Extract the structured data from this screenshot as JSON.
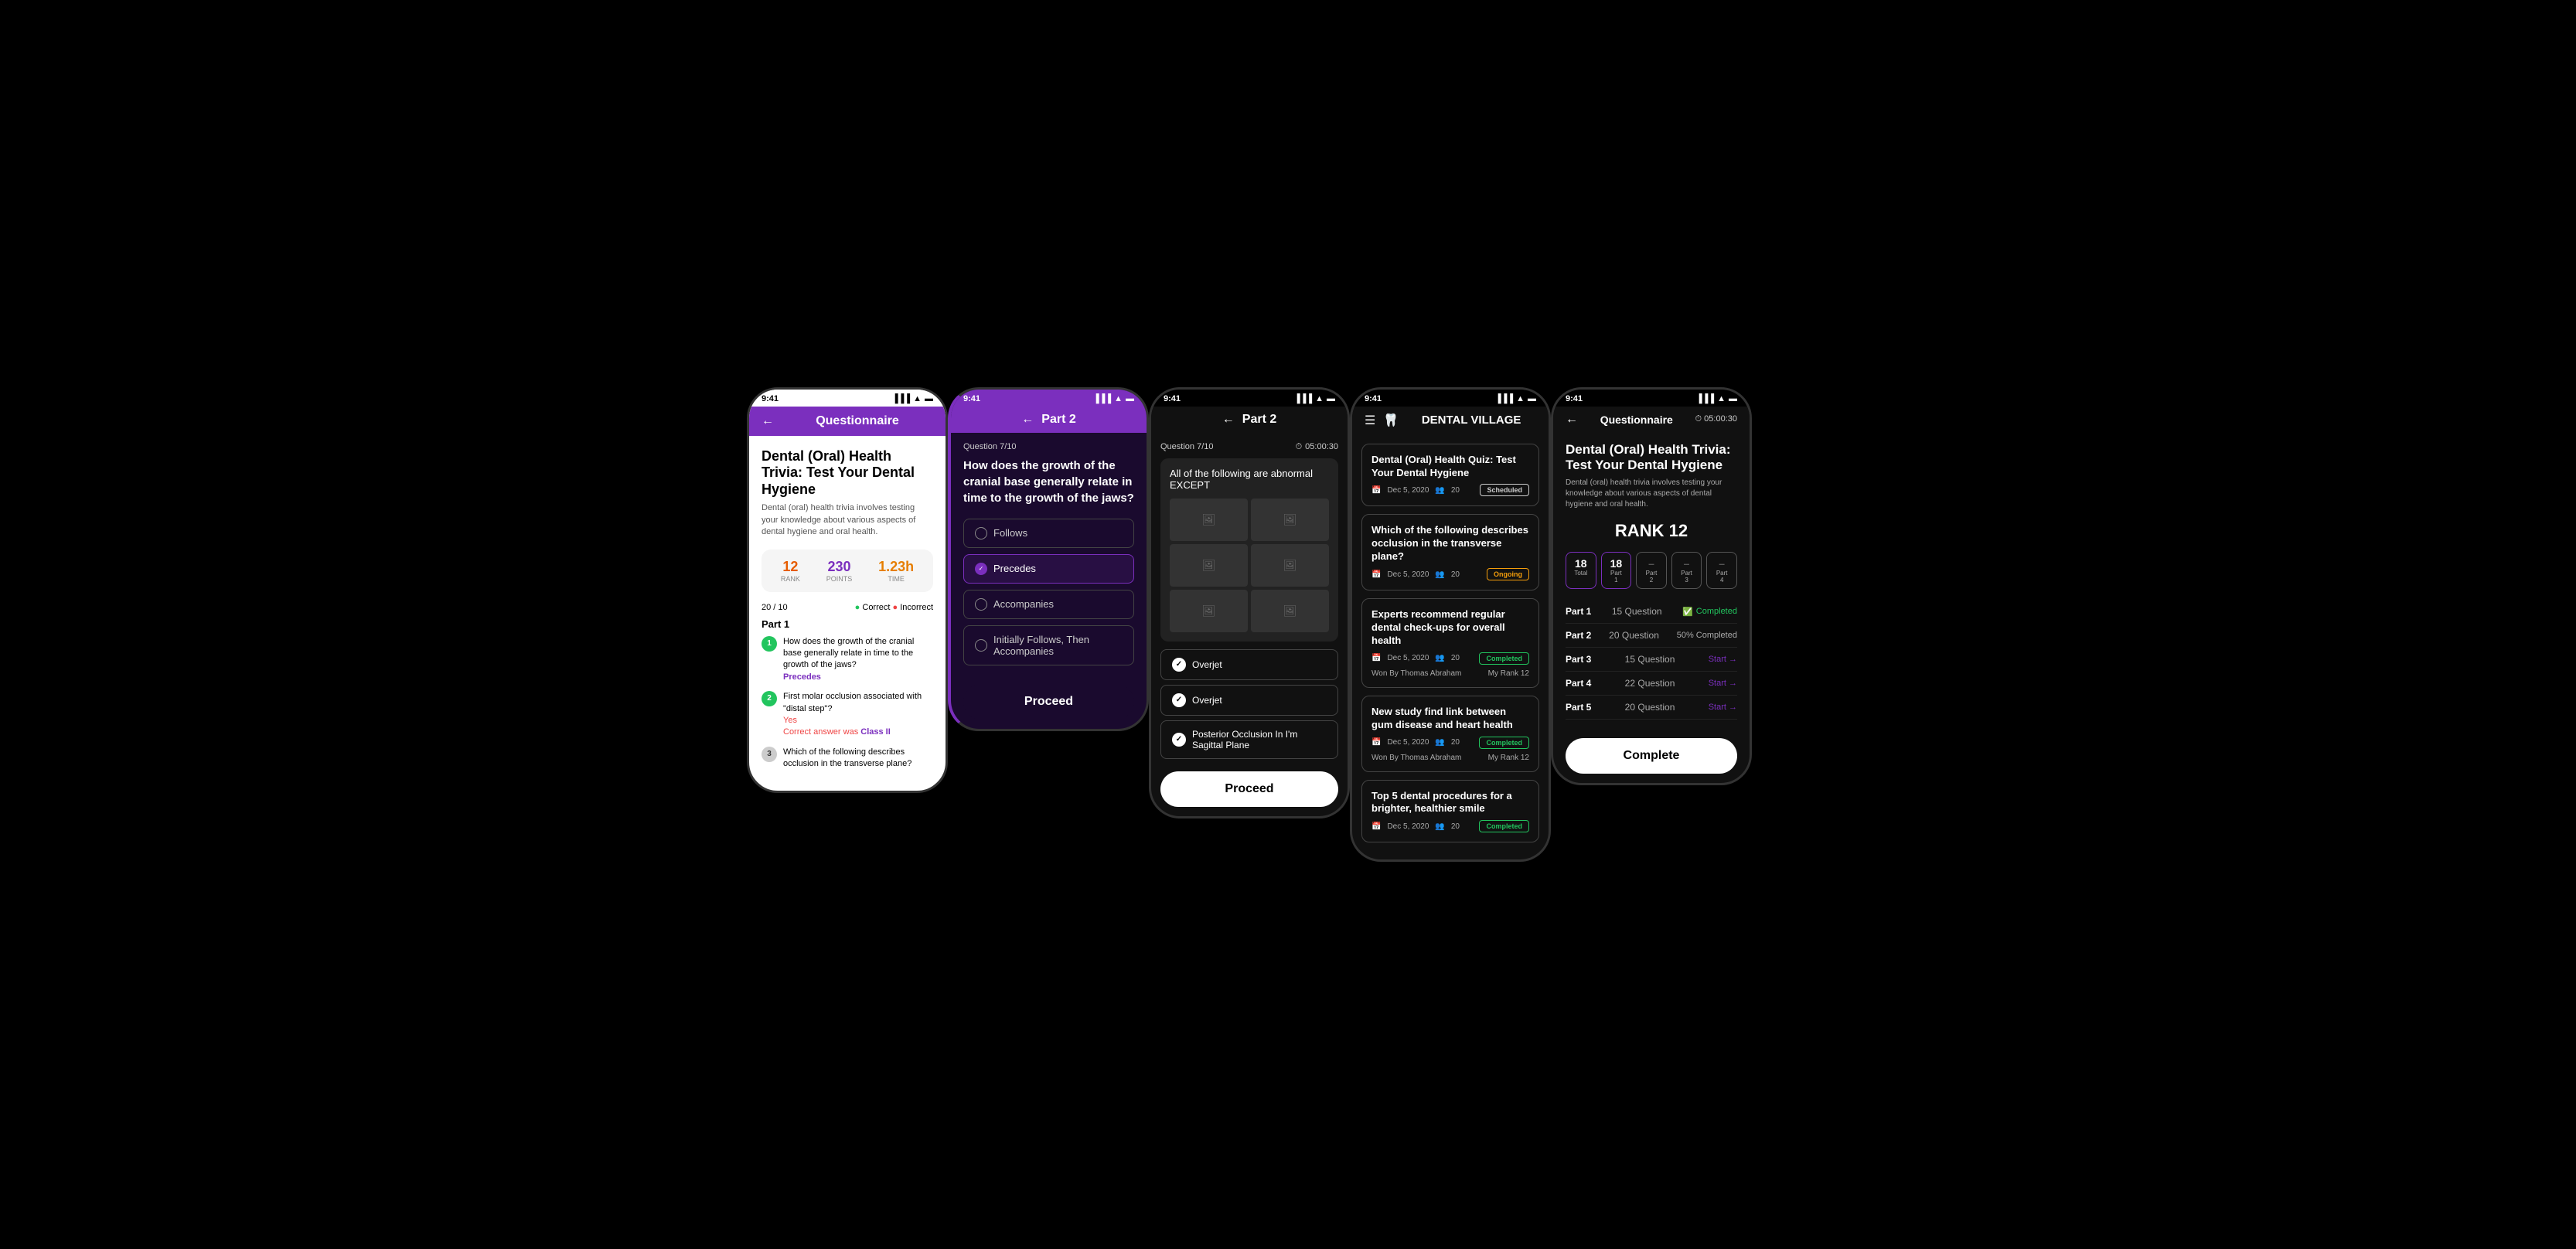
{
  "screen1": {
    "status_time": "9:41",
    "header_title": "Questionnaire",
    "back_label": "←",
    "page_title": "Dental (Oral) Health Trivia: Test Your Dental Hygiene",
    "description": "Dental (oral) health trivia involves testing your knowledge about various aspects of dental hygiene and oral health.",
    "stats": {
      "rank_value": "12",
      "rank_label": "RANK",
      "points_value": "230",
      "points_label": "POINTS",
      "time_value": "1.23h",
      "time_label": "TIME"
    },
    "progress": "20 / 10",
    "correct_label": "Correct",
    "incorrect_label": "Incorrect",
    "part_label": "Part 1",
    "questions": [
      {
        "num": "1",
        "text": "How does the growth of the cranial base generally relate in time to the growth of the jaws?",
        "answer": "Precedes",
        "type": "answered"
      },
      {
        "num": "2",
        "text": "First molar occlusion associated with \"distal step\"?",
        "answer": "Yes",
        "correct_note": "Correct answer was",
        "correct_answer": "Class II",
        "type": "incorrect"
      },
      {
        "num": "3",
        "text": "Which of the following describes occlusion in the transverse plane?",
        "answer": "",
        "type": "unanswered"
      }
    ]
  },
  "screen2": {
    "status_time": "9:41",
    "header_title": "Part 2",
    "back_label": "←",
    "question_label": "Question 7/10",
    "question_text": "How does the growth of the cranial base generally relate in time to the growth of the jaws?",
    "options": [
      {
        "label": "Follows",
        "selected": false
      },
      {
        "label": "Precedes",
        "selected": true
      },
      {
        "label": "Accompanies",
        "selected": false
      },
      {
        "label": "Initially Follows, Then Accompanies",
        "selected": false
      }
    ],
    "proceed_label": "Proceed"
  },
  "screen3": {
    "status_time": "9:41",
    "header_title": "Part 2",
    "back_label": "←",
    "timer": "05:00:30",
    "question_label": "Question 7/10",
    "question_text": "All of the following are abnormal EXCEPT",
    "images": [
      "🖼",
      "🖼",
      "🖼",
      "🖼",
      "🖼",
      "🖼"
    ],
    "options": [
      {
        "label": "Overjet",
        "checked": true
      },
      {
        "label": "Overjet",
        "checked": true
      },
      {
        "label": "Posterior Occlusion In I'm Sagittal Plane",
        "checked": true
      }
    ],
    "proceed_label": "Proceed"
  },
  "screen4": {
    "status_time": "9:41",
    "menu_icon": "☰",
    "brand_logo": "🦷",
    "brand_name": "DENTAL VILLAGE",
    "cards": [
      {
        "title": "Dental (Oral) Health Quiz: Test Your Dental Hygiene",
        "date": "Dec 5, 2020",
        "participants": "20",
        "badge": "Scheduled",
        "badge_type": "scheduled"
      },
      {
        "title": "Which of the following describes occlusion in the transverse plane?",
        "date": "Dec 5, 2020",
        "participants": "20",
        "badge": "Ongoing",
        "badge_type": "ongoing"
      },
      {
        "title": "Experts recommend regular dental check-ups for overall health",
        "date": "Dec 5, 2020",
        "participants": "20",
        "badge": "Completed",
        "badge_type": "completed",
        "won_by": "Thomas Abraham",
        "my_rank": "12"
      },
      {
        "title": "New study find link between gum disease and heart health",
        "date": "Dec 5, 2020",
        "participants": "20",
        "badge": "Completed",
        "badge_type": "completed",
        "won_by": "Thomas Abraham",
        "my_rank": "12"
      },
      {
        "title": "Top 5 dental procedures for a brighter, healthier smile",
        "date": "Dec 5, 2020",
        "participants": "20",
        "badge": "Completed",
        "badge_type": "completed"
      }
    ]
  },
  "screen5": {
    "status_time": "9:41",
    "header_title": "Questionnaire",
    "back_label": "←",
    "timer_icon": "⏱",
    "timer": "05:00:30",
    "page_title": "Dental (Oral) Health Trivia: Test Your Dental Hygiene",
    "description": "Dental (oral) health trivia involves testing your knowledge about various aspects of dental hygiene and oral health.",
    "rank_label": "RANK 12",
    "score_boxes": [
      {
        "value": "18",
        "label": "Total",
        "active": true
      },
      {
        "value": "18",
        "label": "Part 1",
        "active": true
      },
      {
        "value": "–",
        "label": "Part 2",
        "active": false
      },
      {
        "value": "–",
        "label": "Part 3",
        "active": false
      },
      {
        "value": "–",
        "label": "Part 4",
        "active": false
      }
    ],
    "parts": [
      {
        "name": "Part 1",
        "questions": "15 Question",
        "status": "Completed",
        "status_type": "completed"
      },
      {
        "name": "Part 2",
        "questions": "20 Question",
        "status": "50% Completed",
        "status_type": "partial"
      },
      {
        "name": "Part 3",
        "questions": "15 Question",
        "status": "Start →",
        "status_type": "start"
      },
      {
        "name": "Part 4",
        "questions": "22 Question",
        "status": "Start →",
        "status_type": "start"
      },
      {
        "name": "Part 5",
        "questions": "20 Question",
        "status": "Start →",
        "status_type": "start"
      }
    ],
    "complete_label": "Complete"
  }
}
